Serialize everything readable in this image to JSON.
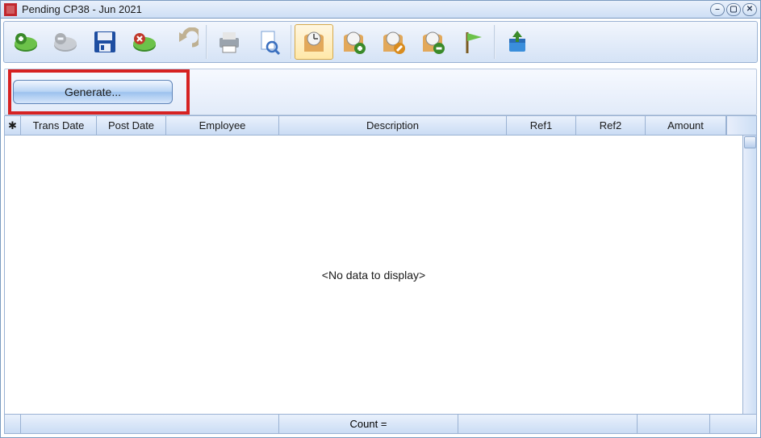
{
  "window": {
    "title": "Pending CP38 - Jun 2021"
  },
  "toolbar": {
    "items": [
      "add-icon",
      "remove-icon",
      "save-icon",
      "discard-icon",
      "undo-icon",
      "print-icon",
      "preview-icon",
      "schedule-icon",
      "schedule-add-icon",
      "schedule-edit-icon",
      "schedule-remove-icon",
      "flag-icon",
      "import-icon"
    ]
  },
  "actions": {
    "generate_label": "Generate..."
  },
  "grid": {
    "columns": [
      "Trans Date",
      "Post Date",
      "Employee",
      "Description",
      "Ref1",
      "Ref2",
      "Amount"
    ],
    "empty_text": "<No data to display>",
    "footer_text": "Count ="
  }
}
